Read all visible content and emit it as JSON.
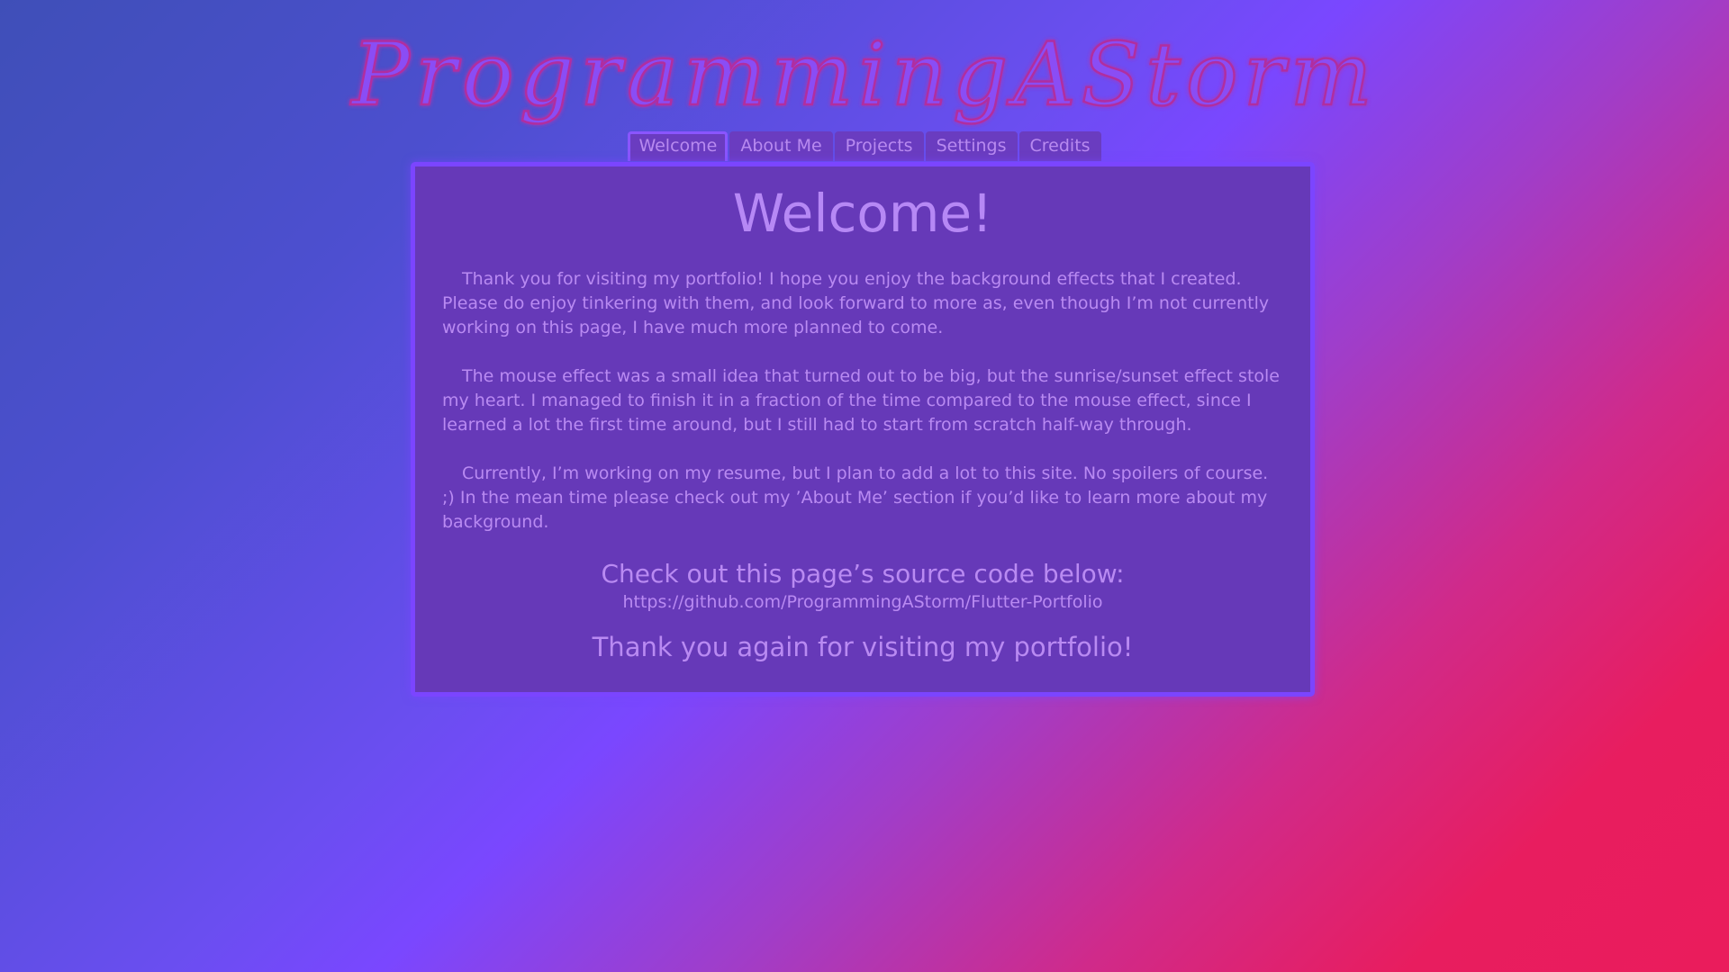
{
  "logo": {
    "text": "ProgrammingAStorm"
  },
  "tabs": [
    {
      "label": "Welcome",
      "active": true
    },
    {
      "label": "About Me",
      "active": false
    },
    {
      "label": "Projects",
      "active": false
    },
    {
      "label": "Settings",
      "active": false
    },
    {
      "label": "Credits",
      "active": false
    }
  ],
  "main": {
    "title": "Welcome!",
    "paragraphs": [
      "Thank you for visiting my portfolio! I hope you enjoy the background effects that I created. Please do enjoy tinkering with them, and look forward to more as, even though I’m not currently working on this page, I have much more planned to come.",
      "The mouse effect was a small idea that turned out to be big, but the sunrise/sunset effect stole my heart. I managed to finish it in a fraction of the time compared to the mouse effect, since I learned a lot the first time around, but I still had to start from scratch half-way through.",
      "Currently, I’m working on my resume, but I plan to add a lot to this site. No spoilers of course. ;) In the mean time please check out my ’About Me’ section if you’d like to learn more about my background."
    ],
    "source_heading": "Check out this page’s source code below:",
    "source_link": "https://github.com/ProgrammingAStorm/Flutter-Portfolio",
    "thanks": "Thank you again for visiting my portfolio!"
  },
  "colors": {
    "accent": "#7b45ff",
    "panel_bg": "#6639b8",
    "text": "#b98af2",
    "logo_stroke": "#b02fa0"
  }
}
